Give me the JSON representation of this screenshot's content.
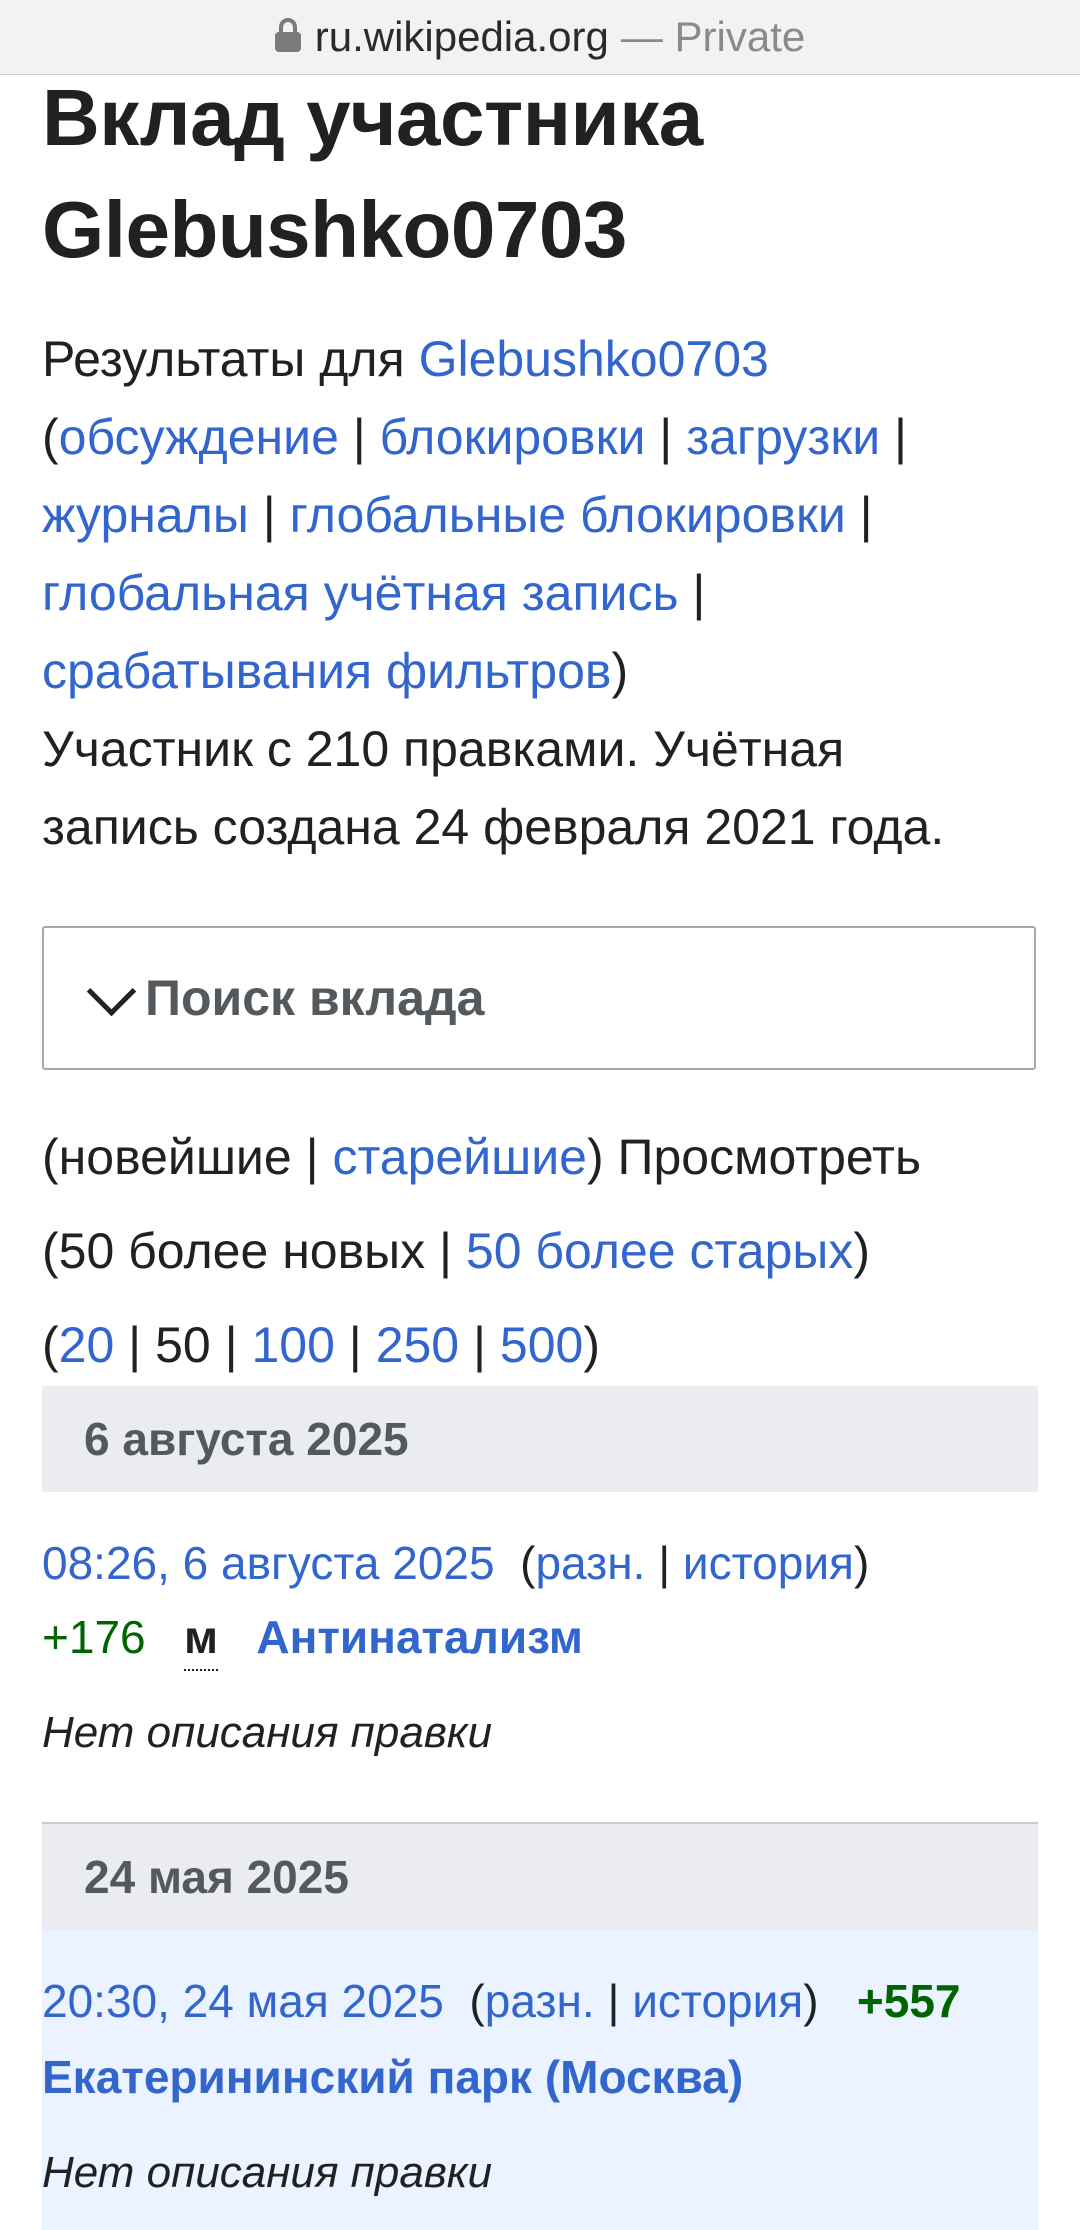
{
  "urlbar": {
    "domain": "ru.wikipedia.org",
    "separator": "—",
    "private_label": "Private"
  },
  "page": {
    "title_line1": "Вклад участника",
    "title_line2": "Glebushko0703"
  },
  "intro": {
    "results_for": "Результаты для",
    "username": "Glebushko0703",
    "links": [
      "обсуждение",
      "блокировки",
      "загрузки",
      "журналы",
      "глобальные блокировки",
      "глобальная учётная запись",
      "срабатывания фильтров"
    ],
    "stats_line1": "Участник с 210 правками. Учётная",
    "stats_line2": "запись создана 24 февраля 2021 года."
  },
  "search": {
    "label": "Поиск вклада"
  },
  "nav": {
    "newest": "новейшие",
    "oldest": "старейшие",
    "view_label": "Просмотреть",
    "newer": "50 более новых",
    "older": "50 более старых",
    "limits": [
      "20",
      "50",
      "100",
      "250",
      "500"
    ],
    "current_limit": "50"
  },
  "groups": [
    {
      "date": "6 августа 2025",
      "entries": [
        {
          "timestamp": "08:26, 6 августа 2025",
          "diff_label": "разн.",
          "history_label": "история",
          "size_change": "+176",
          "minor_flag": "м",
          "article": "Антинатализм",
          "comment": "Нет описания правки"
        }
      ]
    },
    {
      "date": "24 мая 2025",
      "entries": [
        {
          "timestamp": "20:30, 24 мая 2025",
          "diff_label": "разн.",
          "history_label": "история",
          "size_change": "+557",
          "article": "Екатерининский парк (Москва)",
          "comment": "Нет описания правки"
        }
      ]
    }
  ],
  "colors": {
    "link": "#3366cc",
    "positive_change": "#006400",
    "date_header_bg": "#eaecf0",
    "current_edit_bg": "#eaf3ff"
  }
}
